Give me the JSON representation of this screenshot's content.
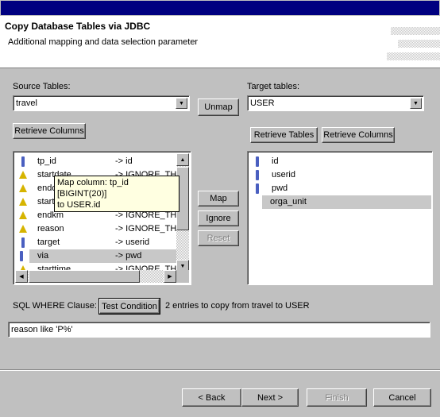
{
  "header": {
    "title": "Copy Database Tables via JDBC",
    "subtitle": "Additional mapping and data selection parameter"
  },
  "source": {
    "label": "Source Tables:",
    "selected": "travel",
    "retrieve_columns": "Retrieve Columns",
    "columns": [
      {
        "icon": "key-icon",
        "name": "tp_id",
        "mapping": "-> id"
      },
      {
        "icon": "warning-icon",
        "name": "startdate",
        "mapping": "-> IGNORE_THI"
      },
      {
        "icon": "warning-icon",
        "name": "enddate",
        "mapping": "-> IGNORE_THI"
      },
      {
        "icon": "warning-icon",
        "name": "startkm",
        "mapping": "-> IGNORE_THI"
      },
      {
        "icon": "warning-icon",
        "name": "endkm",
        "mapping": "-> IGNORE_THI"
      },
      {
        "icon": "warning-icon",
        "name": "reason",
        "mapping": "-> IGNORE_THI"
      },
      {
        "icon": "key-icon",
        "name": "target",
        "mapping": "-> userid"
      },
      {
        "icon": "key-icon",
        "name": "via",
        "mapping": "-> pwd",
        "selected": true
      },
      {
        "icon": "warning-icon",
        "name": "starttime",
        "mapping": "-> IGNORE_THI"
      }
    ],
    "tooltip_line1": "Map column: tp_id [BIGINT(20)]",
    "tooltip_line2": "to USER.id"
  },
  "middle": {
    "unmap": "Unmap",
    "map": "Map",
    "ignore": "Ignore",
    "reset": "Reset"
  },
  "target": {
    "label": "Target tables:",
    "selected": "USER",
    "retrieve_tables": "Retrieve Tables",
    "retrieve_columns": "Retrieve Columns",
    "columns": [
      {
        "icon": "key-icon",
        "name": "id"
      },
      {
        "icon": "key-icon",
        "name": "userid"
      },
      {
        "icon": "key-icon",
        "name": "pwd"
      },
      {
        "icon": "none",
        "name": "orga_unit",
        "selected": true
      }
    ]
  },
  "where": {
    "label": "SQL WHERE Clause:",
    "test_button": "Test Condition",
    "status": "2 entries to copy from travel to USER",
    "value": "reason like 'P%'"
  },
  "footer": {
    "back": "< Back",
    "next": "Next >",
    "finish": "Finish",
    "cancel": "Cancel"
  }
}
